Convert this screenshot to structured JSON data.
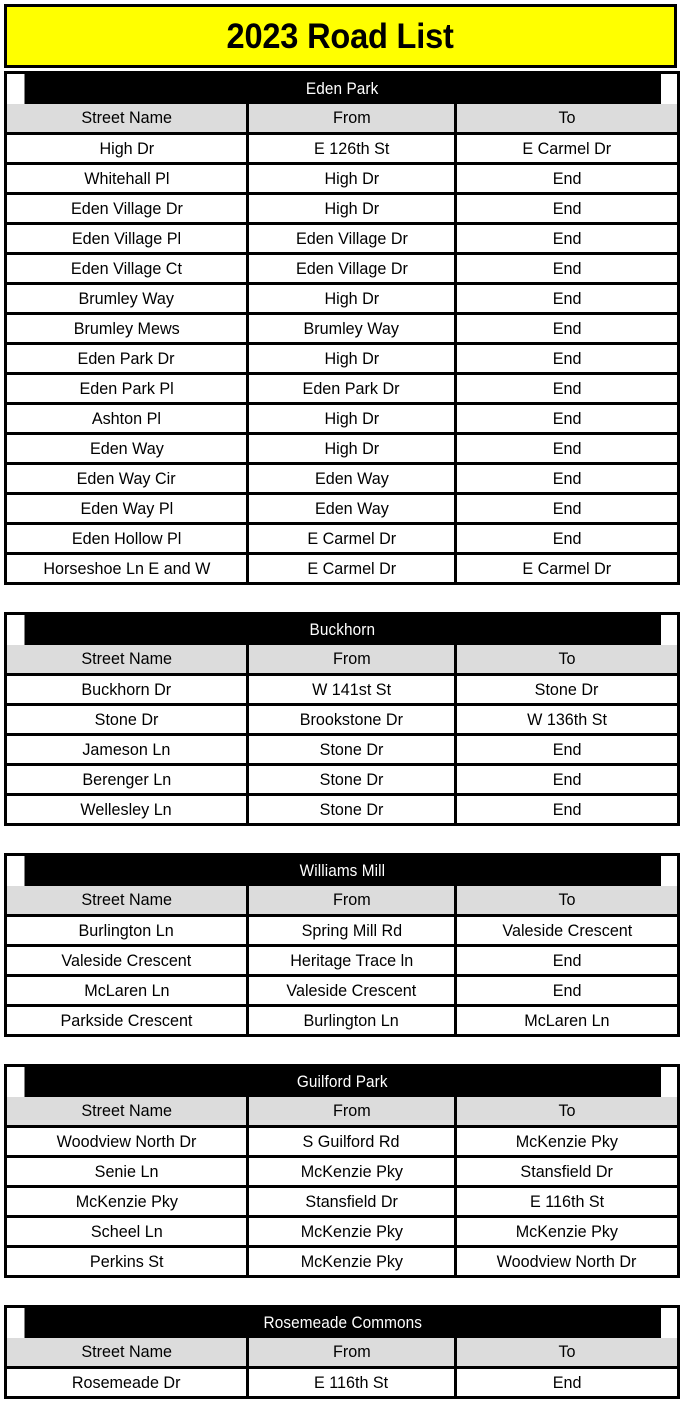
{
  "document": {
    "title": "2023 Road List",
    "title_bg_color": "#FFFF00",
    "section_header_bg_color": "#000000",
    "column_header_bg_color": "#DCDCDC",
    "border_color": "#000000"
  },
  "columns": [
    "Street Name",
    "From",
    "To"
  ],
  "sections": [
    {
      "name": "Eden Park",
      "rows": [
        [
          "High Dr",
          "E 126th St",
          "E Carmel Dr"
        ],
        [
          "Whitehall Pl",
          "High Dr",
          "End"
        ],
        [
          "Eden Village Dr",
          "High Dr",
          "End"
        ],
        [
          "Eden Village Pl",
          "Eden Village Dr",
          "End"
        ],
        [
          "Eden Village Ct",
          "Eden Village Dr",
          "End"
        ],
        [
          "Brumley Way",
          "High Dr",
          "End"
        ],
        [
          "Brumley Mews",
          "Brumley Way",
          "End"
        ],
        [
          "Eden Park Dr",
          "High Dr",
          "End"
        ],
        [
          "Eden Park Pl",
          "Eden Park Dr",
          "End"
        ],
        [
          "Ashton Pl",
          "High Dr",
          "End"
        ],
        [
          "Eden Way",
          "High Dr",
          "End"
        ],
        [
          "Eden Way Cir",
          "Eden Way",
          "End"
        ],
        [
          "Eden Way Pl",
          "Eden Way",
          "End"
        ],
        [
          "Eden Hollow Pl",
          "E Carmel Dr",
          "End"
        ],
        [
          "Horseshoe Ln E and W",
          "E Carmel Dr",
          "E Carmel Dr"
        ]
      ]
    },
    {
      "name": "Buckhorn",
      "rows": [
        [
          "Buckhorn Dr",
          "W 141st St",
          "Stone Dr"
        ],
        [
          "Stone Dr",
          "Brookstone Dr",
          "W 136th St"
        ],
        [
          "Jameson Ln",
          "Stone Dr",
          "End"
        ],
        [
          "Berenger Ln",
          "Stone Dr",
          "End"
        ],
        [
          "Wellesley Ln",
          "Stone Dr",
          "End"
        ]
      ]
    },
    {
      "name": "Williams Mill",
      "rows": [
        [
          "Burlington Ln",
          "Spring Mill Rd",
          "Valeside Crescent"
        ],
        [
          "Valeside Crescent",
          "Heritage Trace ln",
          "End"
        ],
        [
          "McLaren Ln",
          "Valeside Crescent",
          "End"
        ],
        [
          "Parkside Crescent",
          "Burlington Ln",
          "McLaren Ln"
        ]
      ]
    },
    {
      "name": "Guilford Park",
      "rows": [
        [
          "Woodview North Dr",
          "S Guilford Rd",
          "McKenzie Pky"
        ],
        [
          "Senie Ln",
          "McKenzie Pky",
          "Stansfield Dr"
        ],
        [
          "McKenzie Pky",
          "Stansfield Dr",
          "E 116th St"
        ],
        [
          "Scheel Ln",
          "McKenzie Pky",
          "McKenzie Pky"
        ],
        [
          "Perkins St",
          "McKenzie Pky",
          "Woodview North Dr"
        ]
      ]
    },
    {
      "name": "Rosemeade Commons",
      "rows": [
        [
          "Rosemeade Dr",
          "E 116th St",
          "End"
        ]
      ]
    }
  ]
}
